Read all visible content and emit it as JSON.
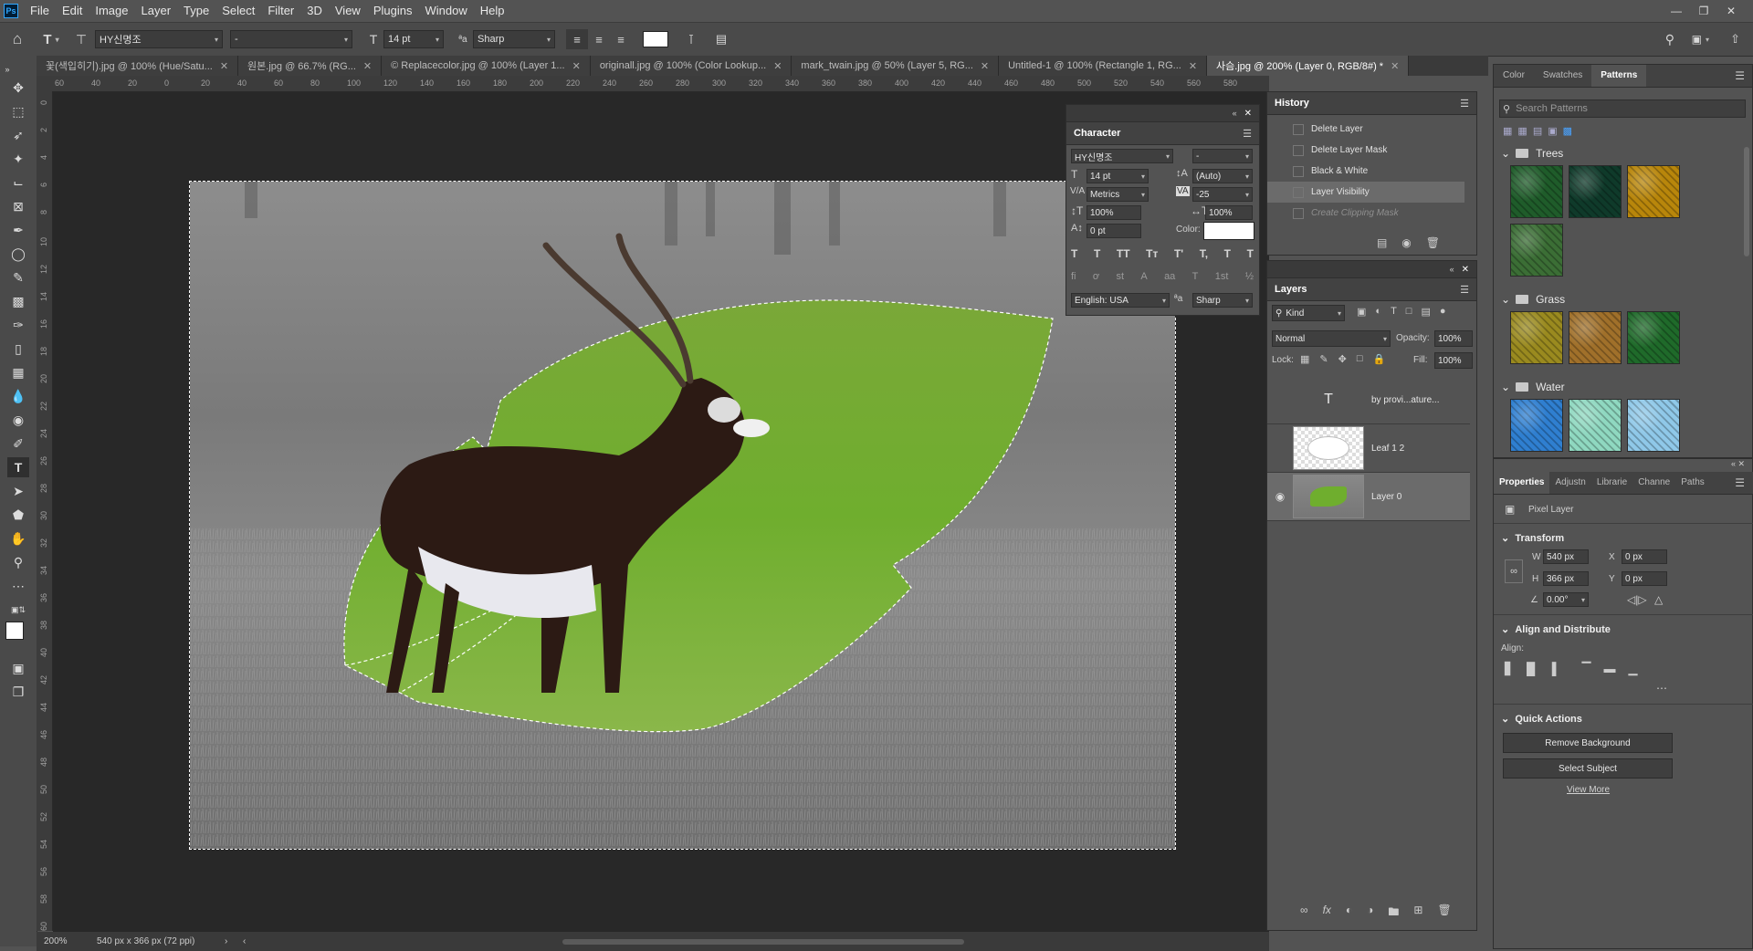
{
  "app": {
    "logo": "Ps"
  },
  "menu": [
    "File",
    "Edit",
    "Image",
    "Layer",
    "Type",
    "Select",
    "Filter",
    "3D",
    "View",
    "Plugins",
    "Window",
    "Help"
  ],
  "options": {
    "font_family": "HY신명조",
    "font_style": "-",
    "font_size": "14 pt",
    "antialias": "Sharp"
  },
  "tabs": [
    {
      "label": "꽃(색입히기).jpg @ 100% (Hue/Satu...",
      "active": false
    },
    {
      "label": "원본.jpg @ 66.7% (RG...",
      "active": false
    },
    {
      "label": "© Replacecolor.jpg @ 100% (Layer 1...",
      "active": false
    },
    {
      "label": "originall.jpg @ 100% (Color Lookup...",
      "active": false
    },
    {
      "label": "mark_twain.jpg @ 50% (Layer 5, RG...",
      "active": false
    },
    {
      "label": "Untitled-1 @ 100% (Rectangle 1, RG...",
      "active": false
    },
    {
      "label": "사슴.jpg @ 200% (Layer 0, RGB/8#) *",
      "active": true
    }
  ],
  "ruler_top": [
    "60",
    "40",
    "20",
    "0",
    "20",
    "40",
    "60",
    "80",
    "100",
    "120",
    "140",
    "160",
    "180",
    "200",
    "220",
    "240",
    "260",
    "280",
    "300",
    "320",
    "340",
    "360",
    "380",
    "400",
    "420",
    "440",
    "460",
    "480",
    "500",
    "520",
    "540",
    "560",
    "580"
  ],
  "ruler_left": [
    "0",
    "2",
    "4",
    "6",
    "8",
    "10",
    "12",
    "14",
    "16",
    "18",
    "20",
    "22",
    "24",
    "26",
    "28",
    "30",
    "32",
    "34",
    "36",
    "38",
    "40",
    "42",
    "44",
    "46",
    "48",
    "50",
    "52",
    "54",
    "56",
    "58",
    "60"
  ],
  "status": {
    "zoom": "200%",
    "info": "540 px x 366 px (72 ppi)"
  },
  "character": {
    "title": "Character",
    "font_family": "HY신명조",
    "font_style": "-",
    "size": "14 pt",
    "leading": "(Auto)",
    "kerning": "Metrics",
    "tracking": "-25",
    "vscale": "100%",
    "hscale": "100%",
    "baseline": "0 pt",
    "color_label": "Color:",
    "style_buttons": [
      "T",
      "T",
      "TT",
      "Tт",
      "T'",
      "T,",
      "T",
      "T"
    ],
    "opentype": [
      "fi",
      "ơ",
      "st",
      "A",
      "aa",
      "T",
      "1st",
      "½"
    ],
    "language": "English: USA",
    "antialias": "Sharp",
    "aa_icon": "ªa"
  },
  "history": {
    "title": "History",
    "items": [
      {
        "label": "Delete Layer",
        "dim": false,
        "sel": false
      },
      {
        "label": "Delete Layer Mask",
        "dim": false,
        "sel": false
      },
      {
        "label": "Black & White",
        "dim": false,
        "sel": false
      },
      {
        "label": "Layer Visibility",
        "dim": false,
        "sel": true
      },
      {
        "label": "Create Clipping Mask",
        "dim": true,
        "sel": false
      }
    ]
  },
  "layers": {
    "title": "Layers",
    "kind": "Kind",
    "blend": "Normal",
    "opacity_label": "Opacity:",
    "opacity": "100%",
    "lock_label": "Lock:",
    "fill_label": "Fill:",
    "fill": "100%",
    "items": [
      {
        "name": "by provi...ature...",
        "type": "text",
        "visible": false
      },
      {
        "name": "Leaf 1 2",
        "type": "shape",
        "visible": false
      },
      {
        "name": "Layer 0",
        "type": "image",
        "visible": true
      }
    ]
  },
  "right_tabs": [
    "Color",
    "Swatches",
    "Patterns"
  ],
  "patterns": {
    "search_placeholder": "Search Patterns",
    "groups": [
      {
        "name": "Trees",
        "colors": [
          "#1f5c2a",
          "#0f3a2a",
          "#b8860b",
          "#3b6e35"
        ]
      },
      {
        "name": "Grass",
        "colors": [
          "#9a8a1f",
          "#a0702a",
          "#1f6a2a"
        ]
      },
      {
        "name": "Water",
        "colors": [
          "#2f7fd0",
          "#8fd8c0",
          "#8fc8e8"
        ]
      }
    ]
  },
  "properties": {
    "tabs": [
      "Properties",
      "Adjustn",
      "Librarie",
      "Channe",
      "Paths"
    ],
    "kind": "Pixel Layer",
    "transform": "Transform",
    "w_label": "W",
    "w": "540 px",
    "h_label": "H",
    "h": "366 px",
    "x_label": "X",
    "x": "0 px",
    "y_label": "Y",
    "y": "0 px",
    "angle": "0.00°",
    "align_title": "Align and Distribute",
    "align_label": "Align:",
    "quick_title": "Quick Actions",
    "remove_bg": "Remove Background",
    "select_subject": "Select Subject",
    "view_more": "View More"
  }
}
